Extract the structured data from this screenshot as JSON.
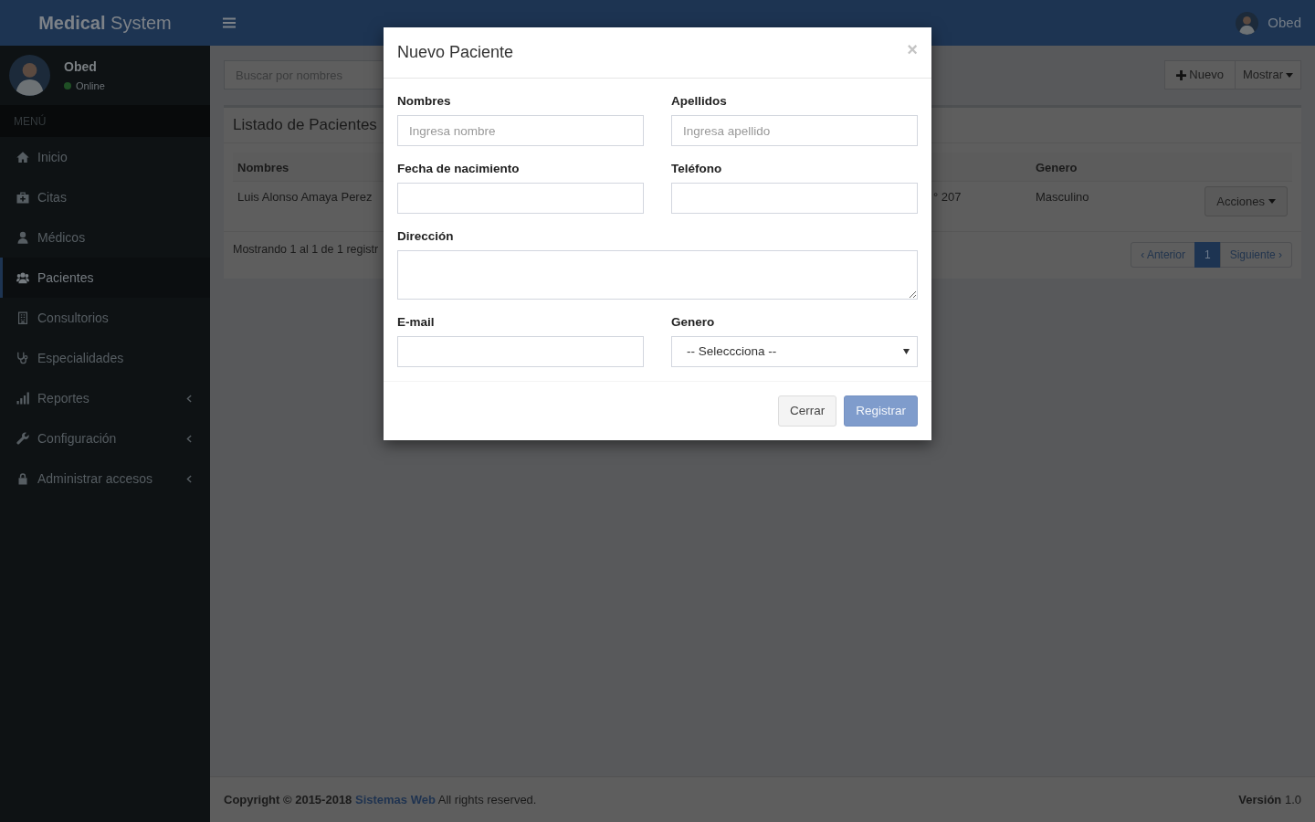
{
  "header": {
    "logo": "**Medical** System",
    "user_name": "Obed"
  },
  "sidebar": {
    "user": {
      "name": "Obed",
      "status": "Online"
    },
    "menu_heading": "MENÚ",
    "items": [
      {
        "label": "Inicio",
        "selected": false,
        "submenu": false
      },
      {
        "label": "Citas",
        "selected": false,
        "submenu": false
      },
      {
        "label": "Médicos",
        "selected": false,
        "submenu": false
      },
      {
        "label": "Pacientes",
        "selected": true,
        "submenu": false
      },
      {
        "label": "Consultorios",
        "selected": false,
        "submenu": false
      },
      {
        "label": "Especialidades",
        "selected": false,
        "submenu": false
      },
      {
        "label": "Reportes",
        "selected": false,
        "submenu": true
      },
      {
        "label": "Configuración",
        "selected": false,
        "submenu": true
      },
      {
        "label": "Administrar accesos",
        "selected": false,
        "submenu": true
      }
    ]
  },
  "toolbar": {
    "search": {
      "placeholder": "Buscar por nombres"
    },
    "buttons": [
      {
        "label": "Nuevo",
        "kind": "add"
      },
      {
        "label": "Mostrar",
        "kind": "dropdown"
      }
    ]
  },
  "panel": {
    "title": "Listado de Pacientes",
    "table": {
      "columns": {
        "name": "Nombres",
        "gender": "Genero"
      },
      "rows": [
        {
          "name": "Luis Alonso Amaya Perez",
          "column_partial": "° 207",
          "gender": "Masculino",
          "actions": "Acciones"
        }
      ]
    },
    "summary": "Mostrando 1 al 1 de 1 registr",
    "pagination": [
      {
        "label": "‹ Anterior",
        "selected": false
      },
      {
        "label": "1",
        "selected": true
      },
      {
        "label": "Siguiente ›",
        "selected": false
      }
    ]
  },
  "footer": {
    "copyright": "Copyright © 2015-2018",
    "link": "Sistemas Web",
    "rights": "All rights reserved.",
    "version": "**Versión** 1.0"
  },
  "modal": {
    "title": "Nuevo Paciente",
    "close": "×",
    "fields": [
      {
        "label": "Nombres",
        "kind": "text",
        "placeholder": "Ingresa nombre"
      },
      {
        "label": "Apellidos",
        "kind": "text",
        "placeholder": "Ingresa apellido"
      },
      {
        "label": "Fecha de nacimiento",
        "kind": "text"
      },
      {
        "label": "Teléfono",
        "kind": "text"
      },
      {
        "label": "Dirección",
        "kind": "textarea"
      },
      {
        "label": "E-mail",
        "kind": "text"
      },
      {
        "label": "Genero",
        "kind": "select",
        "value": "-- Seleccciona --"
      }
    ],
    "buttons": [
      {
        "label": "Cerrar",
        "kind": "default"
      },
      {
        "label": "Registrar",
        "kind": "primary"
      }
    ]
  }
}
